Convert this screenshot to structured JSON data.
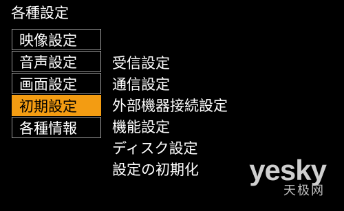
{
  "screen": {
    "title": "各種設定"
  },
  "left_menu": {
    "items": [
      {
        "label": "映像設定",
        "selected": false
      },
      {
        "label": "音声設定",
        "selected": false
      },
      {
        "label": "画面設定",
        "selected": false
      },
      {
        "label": "初期設定",
        "selected": true
      },
      {
        "label": "各種情報",
        "selected": false
      }
    ]
  },
  "right_menu": {
    "items": [
      {
        "label": "受信設定"
      },
      {
        "label": "通信設定"
      },
      {
        "label": "外部機器接続設定"
      },
      {
        "label": "機能設定"
      },
      {
        "label": "ディスク設定"
      },
      {
        "label": "設定の初期化"
      }
    ]
  },
  "watermark": {
    "logo": "yesky",
    "subtitle": "天极网"
  },
  "colors": {
    "background": "#000000",
    "text": "#ffffff",
    "highlight": "#f39c12",
    "border": "#9a9a9a"
  }
}
